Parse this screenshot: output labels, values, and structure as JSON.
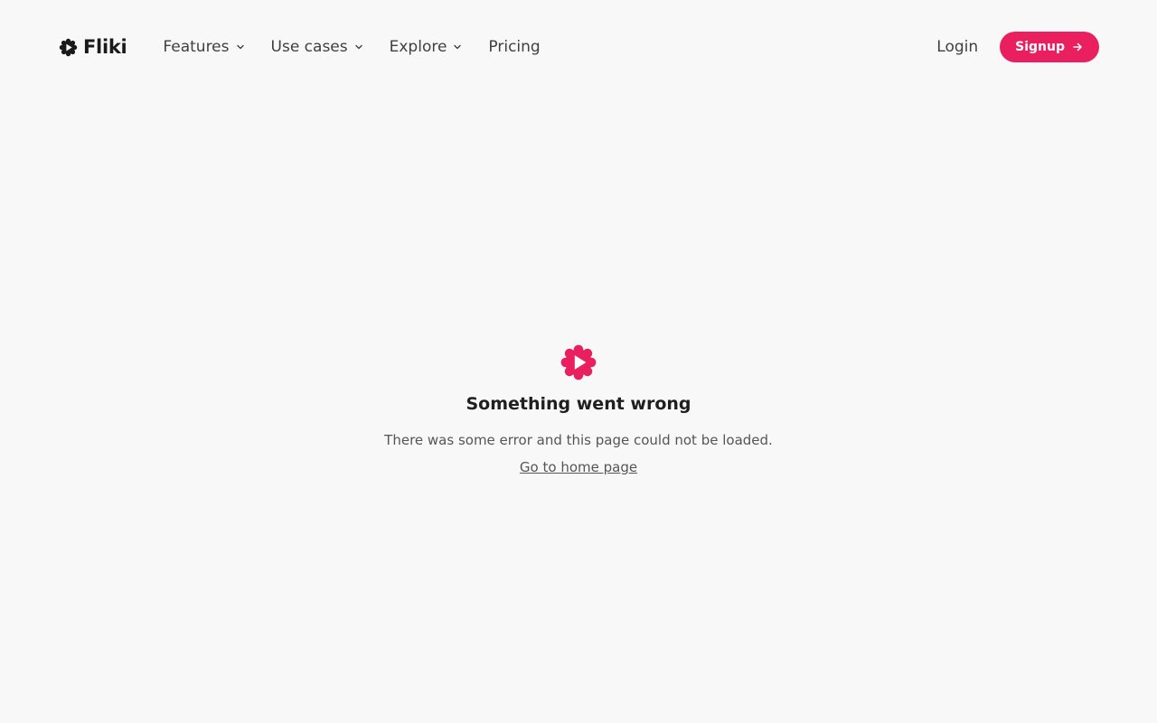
{
  "brand": {
    "name": "Fliki",
    "logo_icon": "flower-play-icon",
    "accent": "#ea1f5f"
  },
  "nav": {
    "items": [
      {
        "label": "Features",
        "has_dropdown": true
      },
      {
        "label": "Use cases",
        "has_dropdown": true
      },
      {
        "label": "Explore",
        "has_dropdown": true
      },
      {
        "label": "Pricing",
        "has_dropdown": false
      }
    ],
    "login_label": "Login",
    "signup_label": "Signup"
  },
  "error": {
    "icon": "flower-play-icon",
    "title_glyph": "",
    "title": "Something went wrong",
    "message": "There was some error and this page could not be loaded.",
    "home_link": "Go to home page"
  }
}
